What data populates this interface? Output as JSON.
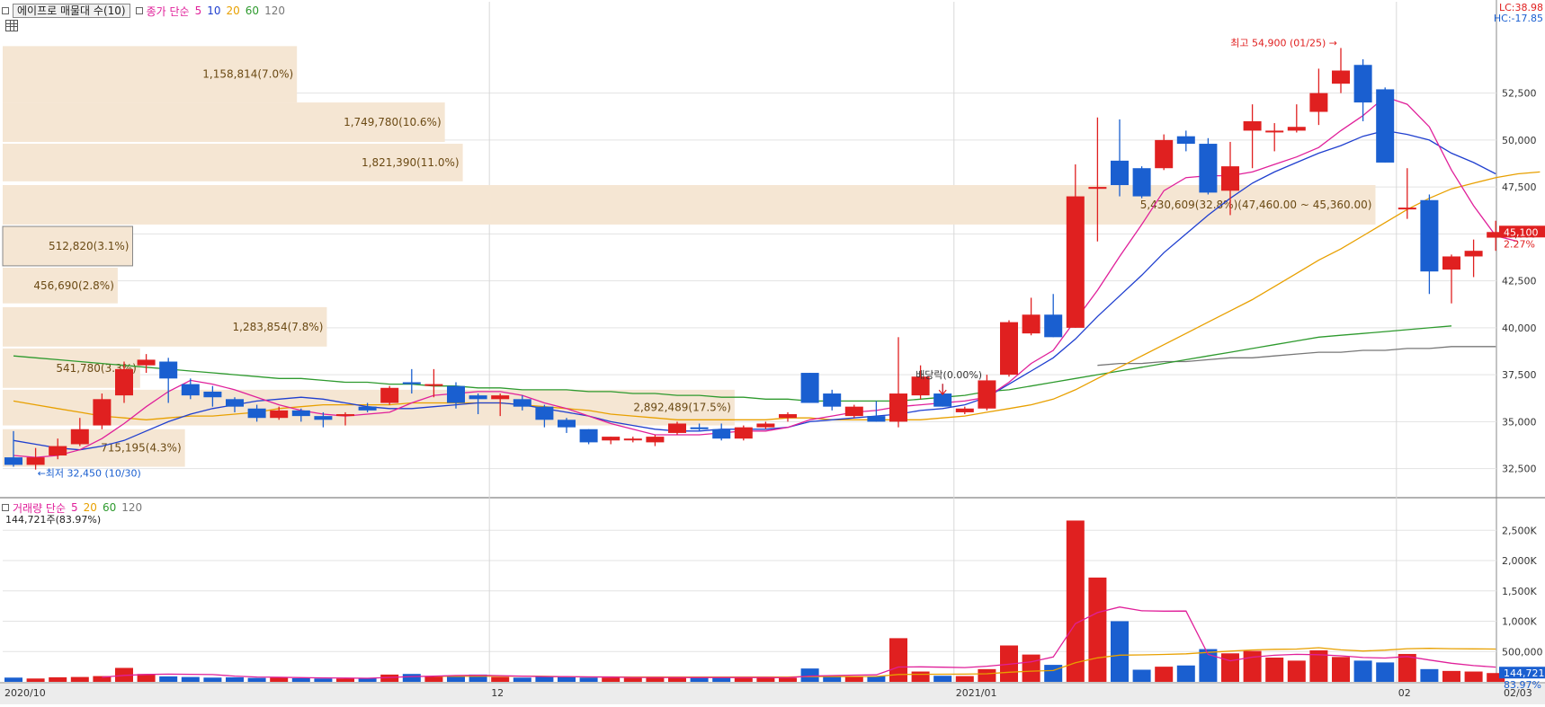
{
  "price_legend": {
    "title": "에이프로 매물대 수(10)",
    "ma_label": "종가 단순",
    "ma_periods": [
      "5",
      "10",
      "20",
      "60",
      "120"
    ],
    "ma_colors": [
      "#e0209a",
      "#1f3fcf",
      "#e8a000",
      "#2e9a2e",
      "#777777"
    ]
  },
  "volume_legend": {
    "title": "거래량 단순",
    "periods": [
      "5",
      "20",
      "60",
      "120"
    ],
    "colors": [
      "#e0209a",
      "#e8a000",
      "#2e9a2e",
      "#777777"
    ],
    "current": "144,721주(83.97%)"
  },
  "top_right": {
    "lc": "LC:38.98",
    "hc": "HC:-17.85"
  },
  "colors": {
    "up": "#e02020",
    "down": "#1a5fd0",
    "profile": "#f5e6d3"
  },
  "chart_data": [
    {
      "type": "candlestick",
      "name": "price",
      "ylim": [
        31000,
        56500
      ],
      "yticks": [
        32500,
        35000,
        37500,
        40000,
        42500,
        45000,
        47500,
        50000,
        52500
      ],
      "ytick_labels": [
        "32,500",
        "35,000",
        "37,500",
        "40,000",
        "42,500",
        "45,000",
        "47,500",
        "50,000",
        "52,500"
      ],
      "xtick_labels": [
        {
          "label": "2020/10",
          "index": 0
        },
        {
          "label": "12",
          "index": 22
        },
        {
          "label": "2021/01",
          "index": 43
        },
        {
          "label": "02",
          "index": 63
        },
        {
          "label": "02/03",
          "index": 67
        }
      ],
      "candles": [
        {
          "o": 33100,
          "h": 34500,
          "l": 32600,
          "c": 32700
        },
        {
          "o": 32700,
          "h": 33600,
          "l": 32450,
          "c": 33100
        },
        {
          "o": 33200,
          "h": 34100,
          "l": 33000,
          "c": 33700
        },
        {
          "o": 33800,
          "h": 35200,
          "l": 33700,
          "c": 34600
        },
        {
          "o": 34800,
          "h": 36500,
          "l": 34600,
          "c": 36200
        },
        {
          "o": 36400,
          "h": 38200,
          "l": 36000,
          "c": 37800
        },
        {
          "o": 38000,
          "h": 38600,
          "l": 37600,
          "c": 38300
        },
        {
          "o": 38200,
          "h": 38400,
          "l": 36000,
          "c": 37300
        },
        {
          "o": 37000,
          "h": 37300,
          "l": 36200,
          "c": 36400
        },
        {
          "o": 36600,
          "h": 36900,
          "l": 35800,
          "c": 36300
        },
        {
          "o": 36200,
          "h": 36300,
          "l": 35500,
          "c": 35800
        },
        {
          "o": 35700,
          "h": 35900,
          "l": 35000,
          "c": 35200
        },
        {
          "o": 35200,
          "h": 35800,
          "l": 35100,
          "c": 35600
        },
        {
          "o": 35600,
          "h": 35700,
          "l": 35000,
          "c": 35300
        },
        {
          "o": 35300,
          "h": 35500,
          "l": 34700,
          "c": 35100
        },
        {
          "o": 35300,
          "h": 35500,
          "l": 34800,
          "c": 35400
        },
        {
          "o": 35800,
          "h": 36000,
          "l": 35500,
          "c": 35600
        },
        {
          "o": 36000,
          "h": 36900,
          "l": 35900,
          "c": 36800
        },
        {
          "o": 37100,
          "h": 37800,
          "l": 36500,
          "c": 37000
        },
        {
          "o": 37000,
          "h": 37800,
          "l": 36300,
          "c": 37000
        },
        {
          "o": 36900,
          "h": 37100,
          "l": 35700,
          "c": 36000
        },
        {
          "o": 36400,
          "h": 36500,
          "l": 35400,
          "c": 36200
        },
        {
          "o": 36200,
          "h": 36500,
          "l": 35300,
          "c": 36400
        },
        {
          "o": 36200,
          "h": 36400,
          "l": 35600,
          "c": 35800
        },
        {
          "o": 35800,
          "h": 35900,
          "l": 34700,
          "c": 35100
        },
        {
          "o": 35100,
          "h": 35200,
          "l": 34400,
          "c": 34700
        },
        {
          "o": 34600,
          "h": 34600,
          "l": 33800,
          "c": 33900
        },
        {
          "o": 34000,
          "h": 34200,
          "l": 33800,
          "c": 34200
        },
        {
          "o": 34100,
          "h": 34200,
          "l": 33900,
          "c": 34100
        },
        {
          "o": 33900,
          "h": 34300,
          "l": 33700,
          "c": 34200
        },
        {
          "o": 34400,
          "h": 35000,
          "l": 34300,
          "c": 34900
        },
        {
          "o": 34700,
          "h": 34900,
          "l": 34500,
          "c": 34600
        },
        {
          "o": 34600,
          "h": 34900,
          "l": 34000,
          "c": 34100
        },
        {
          "o": 34100,
          "h": 34800,
          "l": 34000,
          "c": 34700
        },
        {
          "o": 34700,
          "h": 35000,
          "l": 34600,
          "c": 34900
        },
        {
          "o": 35200,
          "h": 35500,
          "l": 35000,
          "c": 35400
        },
        {
          "o": 37600,
          "h": 37600,
          "l": 36000,
          "c": 36000
        },
        {
          "o": 36500,
          "h": 36700,
          "l": 35600,
          "c": 35800
        },
        {
          "o": 35300,
          "h": 35900,
          "l": 35200,
          "c": 35800
        },
        {
          "o": 35300,
          "h": 36100,
          "l": 35000,
          "c": 35000
        },
        {
          "o": 35000,
          "h": 39500,
          "l": 34700,
          "c": 36500
        },
        {
          "o": 36400,
          "h": 38000,
          "l": 36200,
          "c": 37400
        },
        {
          "o": 36500,
          "h": 37000,
          "l": 35800,
          "c": 35800
        },
        {
          "o": 35500,
          "h": 35800,
          "l": 35400,
          "c": 35700
        },
        {
          "o": 35700,
          "h": 37500,
          "l": 35600,
          "c": 37200
        },
        {
          "o": 37500,
          "h": 40400,
          "l": 37400,
          "c": 40300
        },
        {
          "o": 39700,
          "h": 41600,
          "l": 39600,
          "c": 40700
        },
        {
          "o": 40700,
          "h": 41800,
          "l": 39500,
          "c": 39500
        },
        {
          "o": 40000,
          "h": 48700,
          "l": 40000,
          "c": 47000
        },
        {
          "o": 47400,
          "h": 51200,
          "l": 44600,
          "c": 47500
        },
        {
          "o": 48900,
          "h": 51100,
          "l": 47000,
          "c": 47600
        },
        {
          "o": 48500,
          "h": 48600,
          "l": 46900,
          "c": 47000
        },
        {
          "o": 48500,
          "h": 50300,
          "l": 48400,
          "c": 50000
        },
        {
          "o": 50200,
          "h": 50500,
          "l": 49400,
          "c": 49800
        },
        {
          "o": 49800,
          "h": 50100,
          "l": 47100,
          "c": 47200
        },
        {
          "o": 47300,
          "h": 49900,
          "l": 46000,
          "c": 48600
        },
        {
          "o": 50500,
          "h": 51900,
          "l": 48500,
          "c": 51000
        },
        {
          "o": 50500,
          "h": 50900,
          "l": 49400,
          "c": 50500
        },
        {
          "o": 50500,
          "h": 51900,
          "l": 50400,
          "c": 50700
        },
        {
          "o": 51500,
          "h": 53800,
          "l": 50800,
          "c": 52500
        },
        {
          "o": 53000,
          "h": 54900,
          "l": 52500,
          "c": 53700
        },
        {
          "o": 54000,
          "h": 54300,
          "l": 51000,
          "c": 52000
        },
        {
          "o": 52700,
          "h": 52800,
          "l": 48800,
          "c": 48800
        },
        {
          "o": 46400,
          "h": 48500,
          "l": 45800,
          "c": 46400
        },
        {
          "o": 46800,
          "h": 47100,
          "l": 41800,
          "c": 43000
        },
        {
          "o": 43100,
          "h": 43900,
          "l": 41300,
          "c": 43800
        },
        {
          "o": 43800,
          "h": 44700,
          "l": 42700,
          "c": 44100
        },
        {
          "o": 44800,
          "h": 45700,
          "l": 44100,
          "c": 45100
        }
      ],
      "ma5": [
        33200,
        33100,
        33200,
        33500,
        34100,
        34900,
        35800,
        36600,
        37200,
        37000,
        36700,
        36300,
        35900,
        35600,
        35400,
        35300,
        35400,
        35500,
        36000,
        36400,
        36500,
        36600,
        36600,
        36400,
        36000,
        35700,
        35300,
        34900,
        34600,
        34300,
        34300,
        34300,
        34400,
        34500,
        34500,
        34700,
        35100,
        35300,
        35500,
        35600,
        35800,
        35900,
        36000,
        36100,
        36300,
        37100,
        38100,
        38800,
        40400,
        42000,
        43800,
        45500,
        47300,
        48000,
        48100,
        48100,
        48300,
        48700,
        49100,
        49600,
        50500,
        51300,
        52300,
        51900,
        50700,
        48400,
        46500,
        44900,
        44600
      ],
      "ma10": [
        34000,
        33800,
        33600,
        33500,
        33700,
        34000,
        34500,
        35000,
        35400,
        35700,
        35900,
        36100,
        36200,
        36300,
        36200,
        36000,
        35800,
        35700,
        35700,
        35800,
        35900,
        36000,
        36000,
        35900,
        35700,
        35500,
        35300,
        35000,
        34800,
        34600,
        34500,
        34500,
        34600,
        34600,
        34600,
        34700,
        35000,
        35100,
        35200,
        35300,
        35400,
        35600,
        35700,
        35900,
        36300,
        37000,
        37700,
        38400,
        39400,
        40600,
        41700,
        42800,
        44000,
        45000,
        46000,
        46900,
        47700,
        48300,
        48800,
        49300,
        49700,
        50200,
        50500,
        50300,
        50000,
        49300,
        48800,
        48200
      ],
      "ma20": [
        36100,
        35900,
        35700,
        35500,
        35300,
        35200,
        35100,
        35200,
        35300,
        35300,
        35400,
        35500,
        35700,
        35800,
        35900,
        35900,
        35900,
        35900,
        36000,
        36000,
        36000,
        36000,
        36000,
        35900,
        35800,
        35700,
        35600,
        35400,
        35300,
        35200,
        35100,
        35100,
        35100,
        35100,
        35100,
        35200,
        35200,
        35100,
        35100,
        35100,
        35100,
        35100,
        35200,
        35300,
        35500,
        35700,
        35900,
        36200,
        36700,
        37300,
        37900,
        38500,
        39100,
        39700,
        40300,
        40900,
        41500,
        42200,
        42900,
        43600,
        44200,
        44900,
        45600,
        46300,
        46900,
        47400,
        47700,
        48000,
        48200,
        48300
      ],
      "ma60": [
        38500,
        38400,
        38300,
        38200,
        38100,
        38000,
        37900,
        37800,
        37700,
        37600,
        37500,
        37400,
        37300,
        37300,
        37200,
        37100,
        37100,
        37000,
        37000,
        36900,
        36900,
        36800,
        36800,
        36700,
        36700,
        36700,
        36600,
        36600,
        36500,
        36500,
        36400,
        36400,
        36300,
        36300,
        36200,
        36200,
        36100,
        36100,
        36100,
        36100,
        36100,
        36200,
        36300,
        36400,
        36600,
        36700,
        36900,
        37100,
        37300,
        37500,
        37700,
        37900,
        38100,
        38300,
        38500,
        38700,
        38900,
        39100,
        39300,
        39500,
        39600,
        39700,
        39800,
        39900,
        40000,
        40100
      ],
      "ma120": [
        null,
        null,
        null,
        null,
        null,
        null,
        null,
        null,
        null,
        null,
        null,
        null,
        null,
        null,
        null,
        null,
        null,
        null,
        null,
        null,
        null,
        null,
        null,
        null,
        null,
        null,
        null,
        null,
        null,
        null,
        null,
        null,
        null,
        null,
        null,
        null,
        null,
        null,
        null,
        null,
        null,
        null,
        null,
        null,
        null,
        null,
        null,
        null,
        null,
        38000,
        38100,
        38100,
        38200,
        38200,
        38300,
        38400,
        38400,
        38500,
        38600,
        38700,
        38700,
        38800,
        38800,
        38900,
        38900,
        39000,
        39000,
        39000
      ],
      "volume_profile": [
        {
          "low": 52000,
          "high": 55000,
          "label": "1,158,814(7.0%)",
          "frac": 0.197
        },
        {
          "low": 49900,
          "high": 52000,
          "label": "1,749,780(10.6%)",
          "frac": 0.296
        },
        {
          "low": 47800,
          "high": 49800,
          "label": "1,821,390(11.0%)",
          "frac": 0.308
        },
        {
          "low": 45500,
          "high": 47600,
          "label": "5,430,609(32.8%)(47,460.00 ~ 45,360.00)",
          "frac": 0.919
        },
        {
          "low": 43300,
          "high": 45400,
          "label": "512,820(3.1%)",
          "frac": 0.087
        },
        {
          "low": 41300,
          "high": 43200,
          "label": "456,690(2.8%)",
          "frac": 0.077
        },
        {
          "low": 39000,
          "high": 41100,
          "label": "1,283,854(7.8%)",
          "frac": 0.217
        },
        {
          "low": 36800,
          "high": 38900,
          "label": "541,780(3.3%)",
          "frac": 0.092
        },
        {
          "low": 34800,
          "high": 36700,
          "label": "2,892,489(17.5%)",
          "frac": 0.49
        },
        {
          "low": 32600,
          "high": 34600,
          "label": "715,195(4.3%)",
          "frac": 0.122
        }
      ],
      "annotations": [
        {
          "text": "최고 54,900 (01/25)",
          "index": 60,
          "value": 54900,
          "color": "#e02020",
          "side": "left"
        },
        {
          "text": "최저 32,450 (10/30)",
          "index": 1,
          "value": 32450,
          "color": "#1a5fd0",
          "side": "right"
        },
        {
          "text": "배당락(0.00%)",
          "index": 42,
          "value": 37500,
          "color": "#333333",
          "side": "center"
        }
      ],
      "last_price": {
        "label": "45,100",
        "change": "2.27%",
        "value": 45100
      }
    },
    {
      "type": "bar",
      "name": "volume",
      "ylim": [
        0,
        2800000
      ],
      "yticks": [
        500000,
        1000000,
        1500000,
        2000000,
        2500000
      ],
      "ytick_labels": [
        "500,000",
        "1,000K",
        "1,500K",
        "2,000K",
        "2,500K"
      ],
      "values": [
        70000,
        55000,
        75000,
        80000,
        95000,
        230000,
        130000,
        90000,
        80000,
        70000,
        75000,
        65000,
        70000,
        60000,
        55000,
        55000,
        65000,
        120000,
        130000,
        90000,
        90000,
        120000,
        80000,
        70000,
        85000,
        85000,
        70000,
        70000,
        65000,
        70000,
        80000,
        70000,
        70000,
        65000,
        70000,
        65000,
        220000,
        100000,
        95000,
        95000,
        720000,
        170000,
        100000,
        95000,
        210000,
        600000,
        450000,
        280000,
        2660000,
        1720000,
        1000000,
        200000,
        250000,
        270000,
        540000,
        470000,
        510000,
        400000,
        350000,
        520000,
        410000,
        350000,
        320000,
        460000,
        210000,
        180000,
        170000,
        145000
      ],
      "ma5": [
        null,
        null,
        null,
        null,
        75000,
        107000,
        122000,
        127000,
        125000,
        120000,
        95000,
        80000,
        75000,
        70000,
        65000,
        62000,
        60000,
        73000,
        88000,
        93000,
        105000,
        110000,
        102000,
        94000,
        88000,
        86000,
        82000,
        78000,
        73000,
        72000,
        71000,
        71000,
        71000,
        71000,
        71000,
        68000,
        97000,
        104000,
        111000,
        115000,
        245000,
        247000,
        241000,
        236000,
        258000,
        290000,
        330000,
        410000,
        960000,
        1142000,
        1234000,
        1172000,
        1166000,
        1168000,
        452000,
        346000,
        408000,
        438000,
        454000,
        448000,
        430000,
        402000,
        392000,
        418000,
        360000,
        306000,
        268000,
        243000
      ],
      "ma20": [
        null,
        null,
        null,
        null,
        null,
        null,
        null,
        null,
        null,
        null,
        null,
        null,
        null,
        null,
        null,
        null,
        null,
        null,
        null,
        90000,
        91000,
        94000,
        94000,
        93000,
        92000,
        85000,
        82000,
        81000,
        80000,
        80000,
        80000,
        80000,
        80000,
        80000,
        80000,
        80000,
        88000,
        87000,
        88000,
        89000,
        122000,
        125000,
        126000,
        127000,
        133000,
        158000,
        176000,
        186000,
        315000,
        395000,
        440000,
        445000,
        452000,
        462000,
        486000,
        506000,
        526000,
        537000,
        541000,
        563000,
        528000,
        508000,
        523000,
        547000,
        552000,
        546000,
        543000,
        540000
      ]
    }
  ]
}
